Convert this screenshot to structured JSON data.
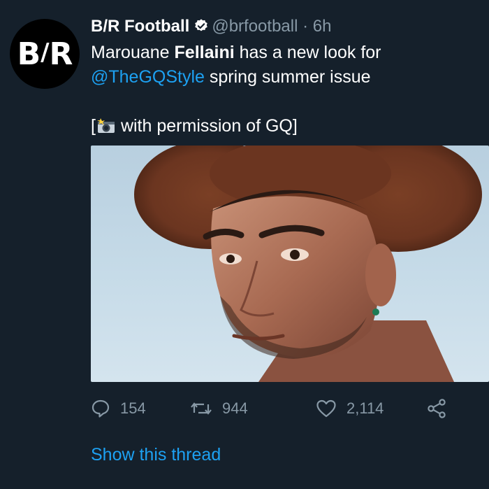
{
  "tweet": {
    "avatar_text_left": "B",
    "avatar_text_right": "R",
    "author_name": "B/R Football",
    "handle": "@brfootball",
    "separator": "·",
    "time": "6h",
    "text_part1": "Marouane ",
    "text_bold": "Fellaini",
    "text_part2": " has a new look for",
    "mention": "@TheGQStyle",
    "text_part3": " spring summer issue",
    "credit_open": "[",
    "credit_text": "with permission of GQ]",
    "photo_alt": "Portrait photo of Marouane Fellaini"
  },
  "actions": {
    "replies": "154",
    "retweets": "944",
    "likes": "2,114"
  },
  "show_thread": "Show this thread",
  "colors": {
    "background": "#15202b",
    "link": "#1da1f2",
    "muted": "#8899a6"
  }
}
